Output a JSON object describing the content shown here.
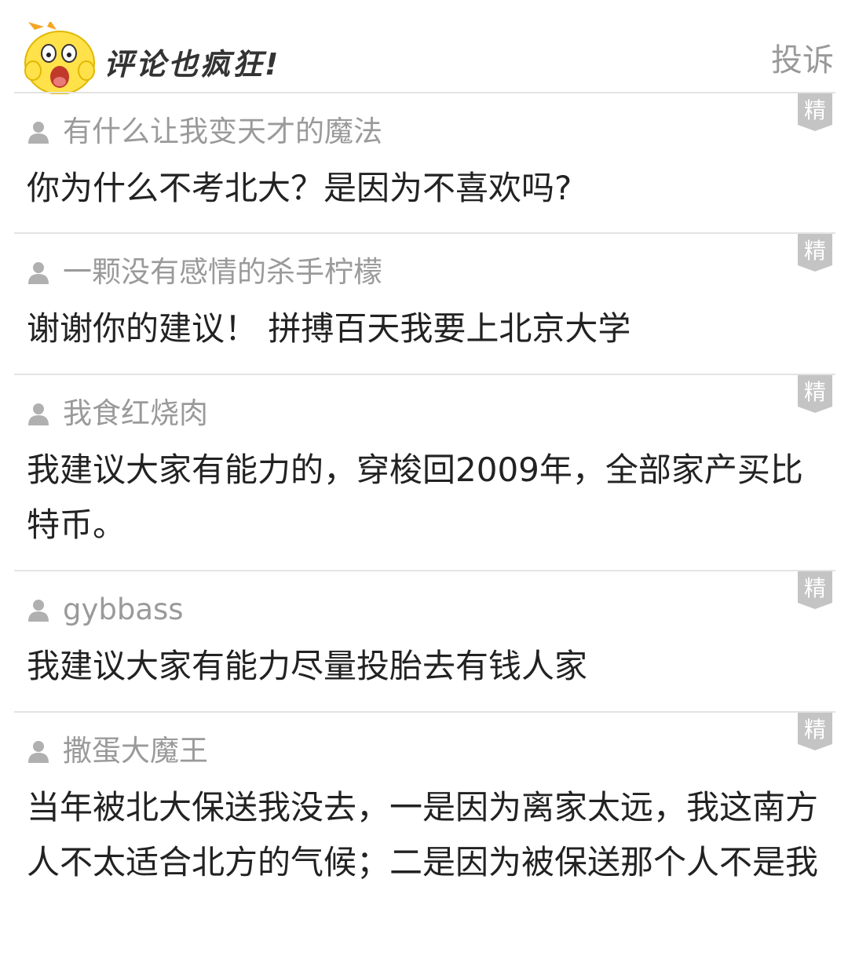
{
  "header": {
    "title": "评论也疯狂!",
    "report_label": "投诉",
    "mascot_icon": "yellow-mascot-icon"
  },
  "badge_label": "精",
  "comments": [
    {
      "username": "有什么让我变天才的魔法",
      "content": "你为什么不考北大？是因为不喜欢吗?"
    },
    {
      "username": "一颗没有感情的杀手柠檬",
      "content": "谢谢你的建议！ 拼搏百天我要上北京大学"
    },
    {
      "username": "我食红烧肉",
      "content": "我建议大家有能力的，穿梭回2009年，全部家产买比特币。"
    },
    {
      "username": "gybbass",
      "content": "我建议大家有能力尽量投胎去有钱人家"
    },
    {
      "username": "撒蛋大魔王",
      "content": "当年被北大保送我没去，一是因为离家太远，我这南方人不太适合北方的气候；二是因为被保送那个人不是我"
    }
  ],
  "colors": {
    "badge_bg": "#c4c4c4",
    "username": "#9a9a9a",
    "content": "#222222",
    "divider": "#e3e3e3",
    "mascot": "#ffe14a"
  }
}
